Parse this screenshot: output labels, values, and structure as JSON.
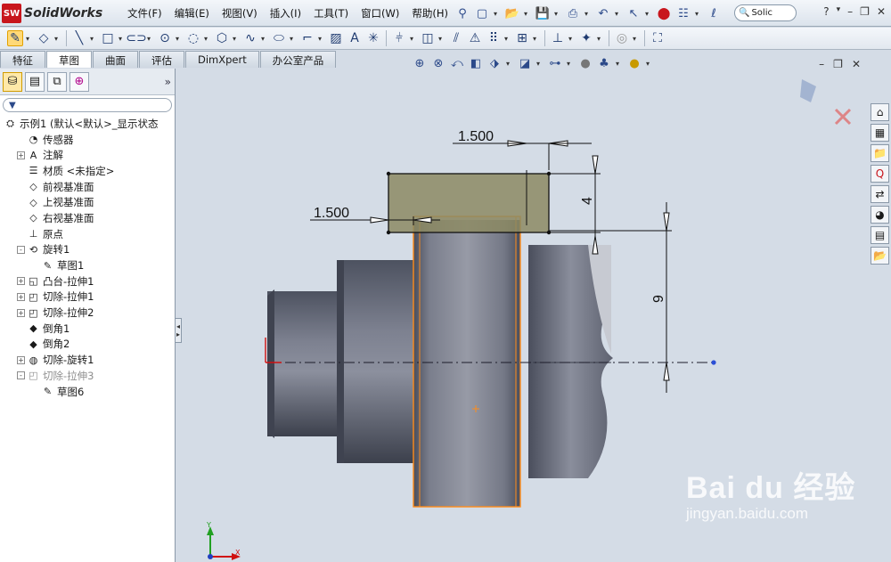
{
  "app": {
    "name": "SolidWorks",
    "logo_text": "SW"
  },
  "menus": [
    "文件(F)",
    "编辑(E)",
    "视图(V)",
    "插入(I)",
    "工具(T)",
    "窗口(W)",
    "帮助(H)"
  ],
  "search": {
    "value": "Solic"
  },
  "tabs": [
    {
      "label": "特征",
      "active": false
    },
    {
      "label": "草图",
      "active": true
    },
    {
      "label": "曲面",
      "active": false
    },
    {
      "label": "评估",
      "active": false
    },
    {
      "label": "DimXpert",
      "active": false
    },
    {
      "label": "办公室产品",
      "active": false
    }
  ],
  "tree": [
    {
      "label": "示例1  (默认<默认>_显示状态",
      "icon": "part-icon",
      "depth": 0,
      "expander": "",
      "dim": false
    },
    {
      "label": "传感器",
      "icon": "sensor-icon",
      "depth": 1,
      "expander": "",
      "dim": false
    },
    {
      "label": "注解",
      "icon": "annotation-icon",
      "depth": 1,
      "expander": "+",
      "dim": false
    },
    {
      "label": "材质 <未指定>",
      "icon": "material-icon",
      "depth": 1,
      "expander": "",
      "dim": false
    },
    {
      "label": "前视基准面",
      "icon": "plane-icon",
      "depth": 1,
      "expander": "",
      "dim": false
    },
    {
      "label": "上视基准面",
      "icon": "plane-icon",
      "depth": 1,
      "expander": "",
      "dim": false
    },
    {
      "label": "右视基准面",
      "icon": "plane-icon",
      "depth": 1,
      "expander": "",
      "dim": false
    },
    {
      "label": "原点",
      "icon": "origin-icon",
      "depth": 1,
      "expander": "",
      "dim": false
    },
    {
      "label": "旋转1",
      "icon": "revolve-icon",
      "depth": 1,
      "expander": "-",
      "dim": false
    },
    {
      "label": "草图1",
      "icon": "sketch-icon",
      "depth": 2,
      "expander": "",
      "dim": false
    },
    {
      "label": "凸台-拉伸1",
      "icon": "extrude-icon",
      "depth": 1,
      "expander": "+",
      "dim": false
    },
    {
      "label": "切除-拉伸1",
      "icon": "cut-extrude-icon",
      "depth": 1,
      "expander": "+",
      "dim": false
    },
    {
      "label": "切除-拉伸2",
      "icon": "cut-extrude-icon",
      "depth": 1,
      "expander": "+",
      "dim": false
    },
    {
      "label": "倒角1",
      "icon": "chamfer-icon",
      "depth": 1,
      "expander": "",
      "dim": false
    },
    {
      "label": "倒角2",
      "icon": "chamfer-icon",
      "depth": 1,
      "expander": "",
      "dim": false
    },
    {
      "label": "切除-旋转1",
      "icon": "cut-revolve-icon",
      "depth": 1,
      "expander": "+",
      "dim": false
    },
    {
      "label": "切除-拉伸3",
      "icon": "cut-extrude-icon",
      "depth": 1,
      "expander": "-",
      "dim": true
    },
    {
      "label": "草图6",
      "icon": "sketch-icon",
      "depth": 2,
      "expander": "",
      "dim": false
    }
  ],
  "dimensions": {
    "top_width": "1.500",
    "left_width": "1.500",
    "height_small": "4",
    "height_large": "9"
  },
  "watermark": {
    "brand": "Bai du 经验",
    "url": "jingyan.baidu.com"
  },
  "colors": {
    "sketch_fill": "#8c8a63",
    "body": "#5d6271",
    "selection": "#ff8c1a",
    "background": "#d4dce6"
  }
}
